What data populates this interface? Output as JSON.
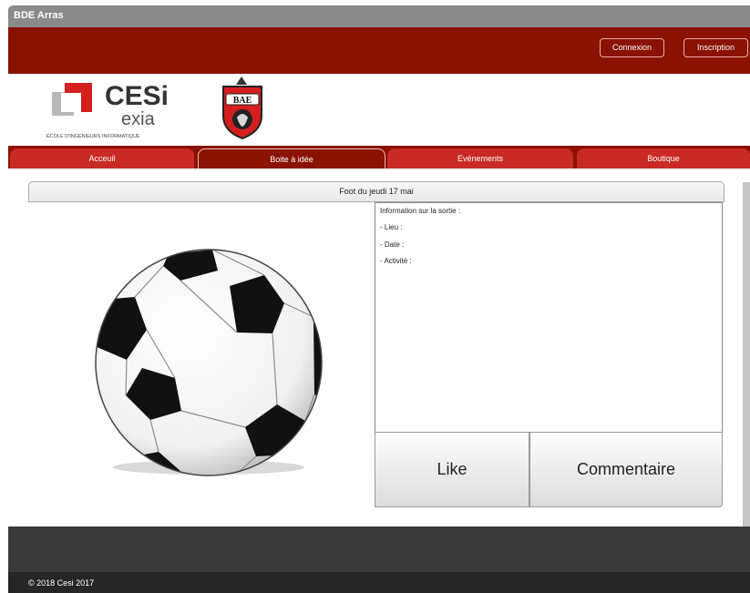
{
  "window": {
    "title": "BDE Arras"
  },
  "header": {
    "login_label": "Connexion",
    "signup_label": "Inscription"
  },
  "logos": {
    "cesi_main": "CESi",
    "cesi_sub": "exia",
    "cesi_tagline": "ÉCOLE D'INGÉNIEURS INFORMATIQUE",
    "bde_text": "BAE"
  },
  "nav": {
    "tabs": [
      {
        "label": "Acceuil"
      },
      {
        "label": "Boite à idée"
      },
      {
        "label": "Evénements"
      },
      {
        "label": "Boutique"
      }
    ],
    "active_index": 1
  },
  "event": {
    "title": "Foot du jeudi 17 mai",
    "info_heading": "Information sur la sortie :",
    "info_lines": [
      "- Lieu :",
      "- Date :",
      "- Activité :"
    ],
    "image_icon": "soccer-ball-icon",
    "like_label": "Like",
    "comment_label": "Commentaire"
  },
  "footer": {
    "copyright": "© 2018 Cesi 2017"
  },
  "colors": {
    "brand_dark_red": "#8a1200",
    "tab_red": "#c92a24",
    "cesi_red": "#d41f1f",
    "footer_dark": "#3a3a3a"
  }
}
